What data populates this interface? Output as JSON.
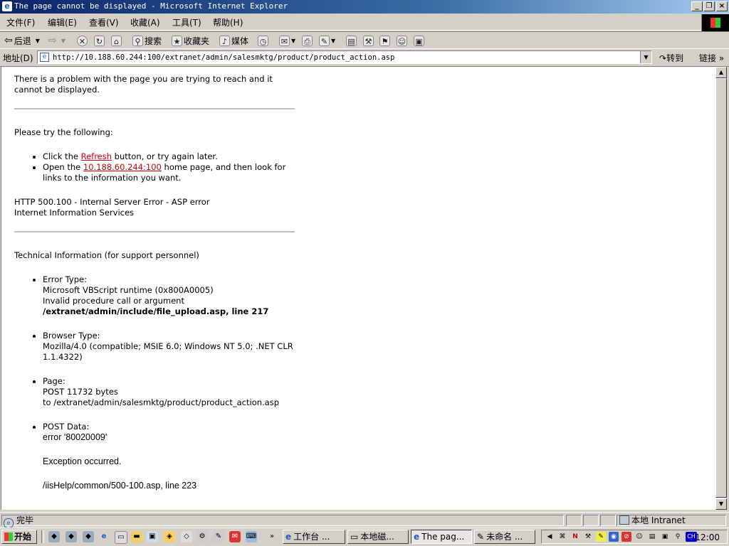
{
  "window": {
    "title": "The page cannot be displayed - Microsoft Internet Explorer"
  },
  "menu": [
    "文件(F)",
    "编辑(E)",
    "查看(V)",
    "收藏(A)",
    "工具(T)",
    "帮助(H)"
  ],
  "toolbar": {
    "back": "后退",
    "search": "搜索",
    "favorites": "收藏夹",
    "media": "媒体"
  },
  "address": {
    "label": "地址(D)",
    "url": "http://10.188.60.244:100/extranet/admin/salesmktg/product/product_action.asp",
    "go": "转到",
    "links": "链接"
  },
  "page": {
    "intro": "There is a problem with the page you are trying to reach and it cannot be displayed.",
    "try_heading": "Please try the following:",
    "bullet1_pre": "Click the ",
    "bullet1_link": "Refresh",
    "bullet1_post": " button, or try again later.",
    "bullet2_pre": "Open the ",
    "bullet2_link": "10.188.60.244:100",
    "bullet2_post": " home page, and then look for links to the information you want.",
    "http_error": "HTTP 500.100 - Internal Server Error - ASP error",
    "iis": "Internet Information Services",
    "tech_heading": "Technical Information (for support personnel)",
    "error_type_label": "Error Type:",
    "error_type_1": "Microsoft VBScript runtime (0x800A0005)",
    "error_type_2": "Invalid procedure call or argument",
    "error_type_3": "/extranet/admin/include/file_upload.asp, line 217",
    "browser_label": "Browser Type:",
    "browser_value": "Mozilla/4.0 (compatible; MSIE 6.0; Windows NT 5.0; .NET CLR 1.1.4322)",
    "page_label": "Page:",
    "page_1": "POST 11732 bytes",
    "page_2": "to /extranet/admin/salesmktg/product/product_action.asp",
    "post_label": "POST Data:",
    "post_1": "error '80020009'",
    "post_2": "Exception occurred.",
    "post_3": "/iisHelp/common/500-100.asp, line 223"
  },
  "status": {
    "text": "完毕",
    "zone": "本地 Intranet"
  },
  "taskbar": {
    "start": "开始",
    "tasks": [
      "工作台 ...",
      "本地磁...",
      "The pag...",
      "未命名 ..."
    ],
    "clock": "12:00",
    "tray_lang": "CH"
  }
}
